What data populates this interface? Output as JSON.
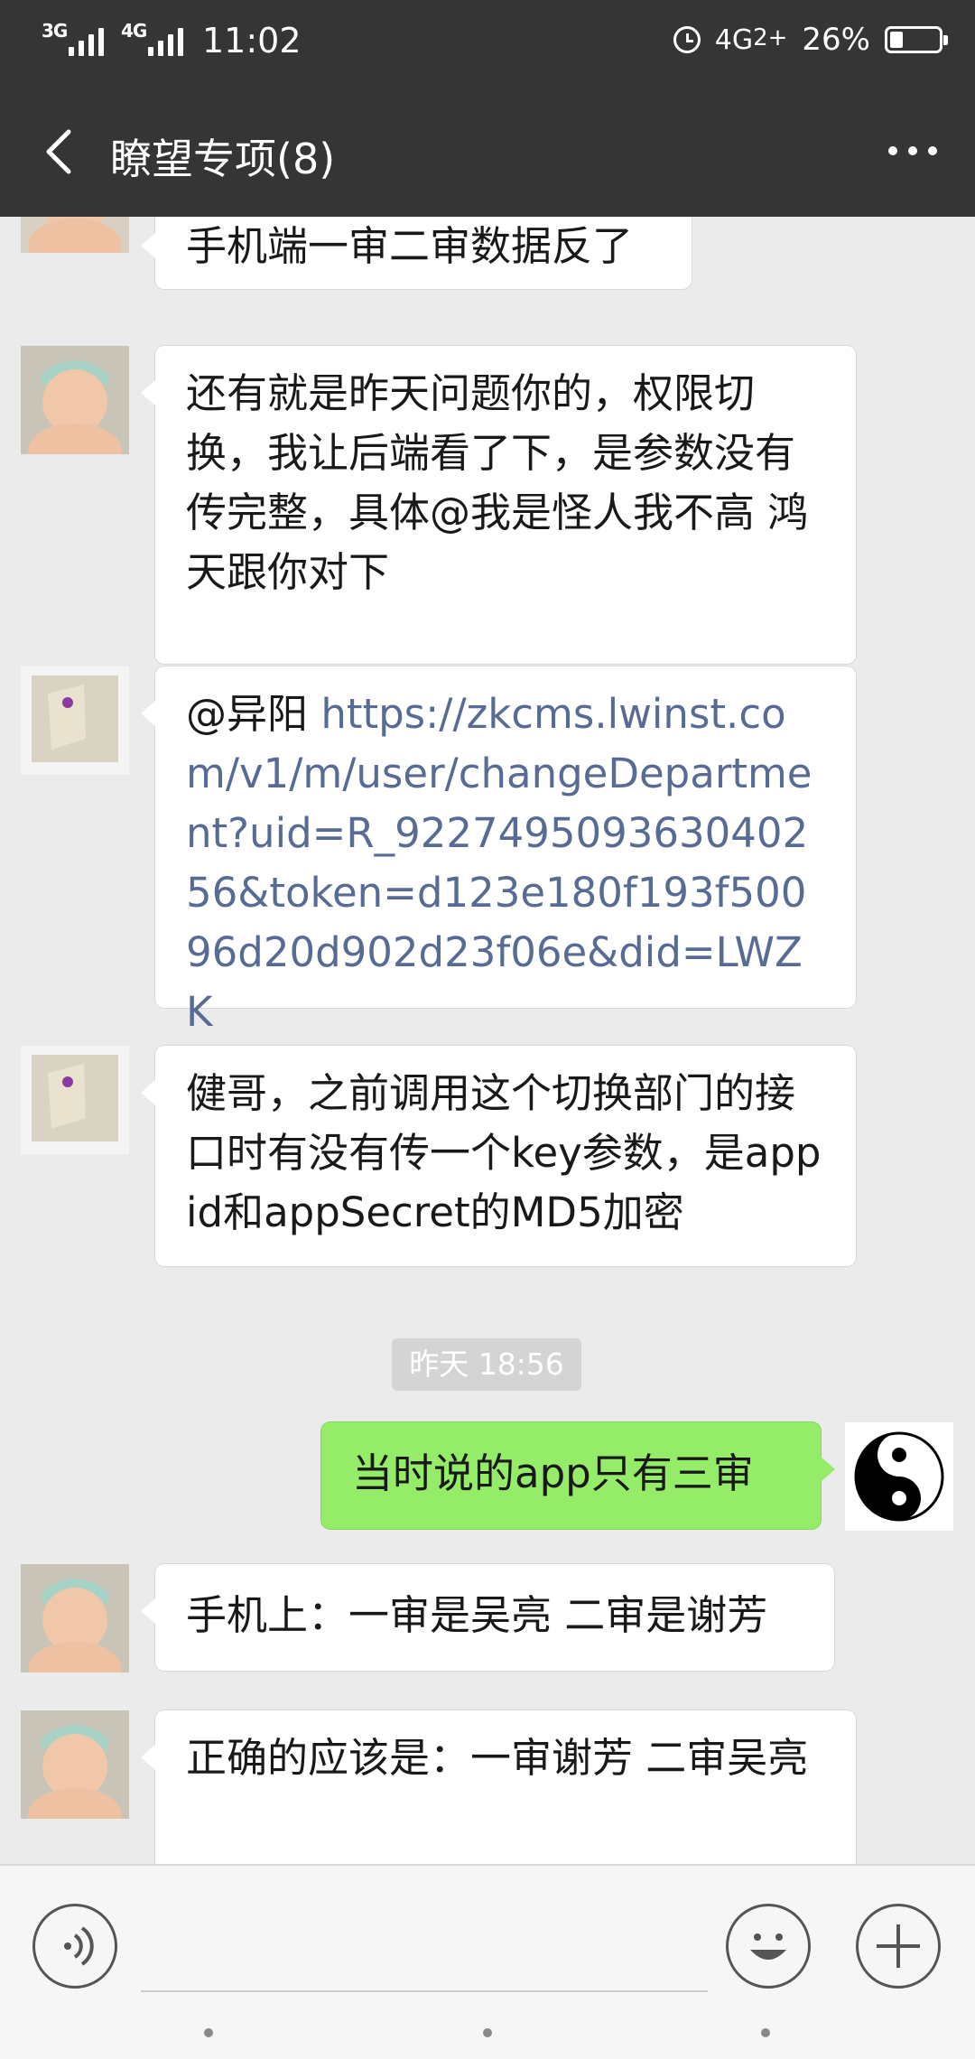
{
  "status_bar": {
    "sim1": "3G",
    "sim2": "4G",
    "time": "11:02",
    "network": "4G",
    "network_sub": "2+",
    "battery_text": "26%",
    "battery_level": 0.26
  },
  "header": {
    "title": "瞭望专项(8)"
  },
  "messages": [
    {
      "side": "left",
      "avatar": "baby-avatar",
      "text": "手机端一审二审数据反了"
    },
    {
      "side": "left",
      "avatar": "baby-avatar",
      "text": "还有就是昨天问题你的，权限切换，我让后端看了下，是参数没有传完整，具体@我是怪人我不高 鸿天跟你对下"
    },
    {
      "side": "left",
      "avatar": "photo-avatar",
      "mention": "@异阳 ",
      "link": "https://zkcms.lwinst.com/v1/m/user/changeDepartment?uid=R_9227495093630402 56&token=d123e180f193f50096d20d902d23f06e&did=LWZK"
    },
    {
      "side": "left",
      "avatar": "photo-avatar",
      "text": "健哥，之前调用这个切换部门的接口时有没有传一个key参数，是appid和appSecret的MD5加密"
    },
    {
      "side": "right",
      "avatar": "yin-yang-avatar",
      "text": "当时说的app只有三审"
    },
    {
      "side": "left",
      "avatar": "baby-avatar",
      "text": "手机上：一审是吴亮 二审是谢芳"
    },
    {
      "side": "left",
      "avatar": "baby-avatar",
      "text": "正确的应该是：一审谢芳  二审吴亮"
    }
  ],
  "timestamp": "昨天 18:56",
  "colors": {
    "header_bg": "#353535",
    "chat_bg": "#ebebeb",
    "sent_bubble": "#95ec69",
    "received_bubble": "#ffffff",
    "link": "#576b95"
  }
}
